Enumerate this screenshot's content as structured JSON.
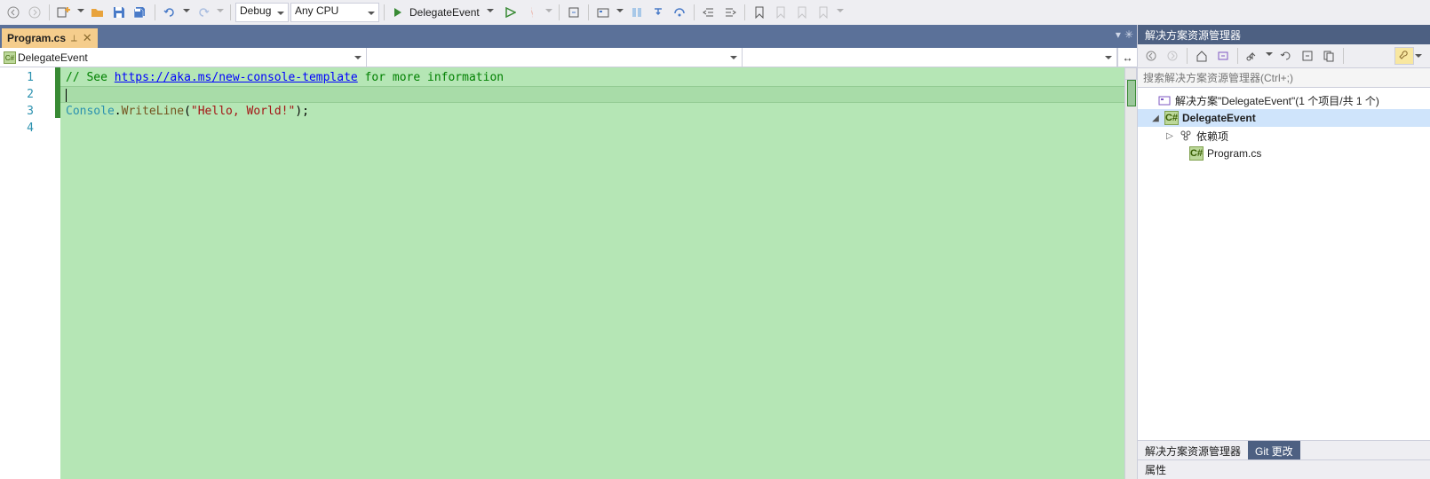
{
  "toolbar": {
    "config": "Debug",
    "platform": "Any CPU",
    "runTarget": "DelegateEvent"
  },
  "tab": {
    "title": "Program.cs"
  },
  "navbar": {
    "scope": "DelegateEvent"
  },
  "editor": {
    "lines": [
      "1",
      "2",
      "3",
      "4"
    ],
    "commentPrefix": "// See ",
    "link": "https://aka.ms/new-console-template",
    "commentSuffix": " for more information",
    "code_type": "Console",
    "code_dot": ".",
    "code_method": "WriteLine",
    "code_open": "(",
    "code_string": "\"Hello, World!\"",
    "code_close": ");"
  },
  "solutionExplorer": {
    "title": "解决方案资源管理器",
    "searchPlaceholder": "搜索解决方案资源管理器(Ctrl+;)",
    "solutionLabel": "解决方案\"DelegateEvent\"(1 个项目/共 1 个)",
    "project": "DelegateEvent",
    "deps": "依赖项",
    "file": "Program.cs",
    "tabActive": "解决方案资源管理器",
    "tabGit": "Git 更改"
  },
  "properties": {
    "title": "属性"
  }
}
